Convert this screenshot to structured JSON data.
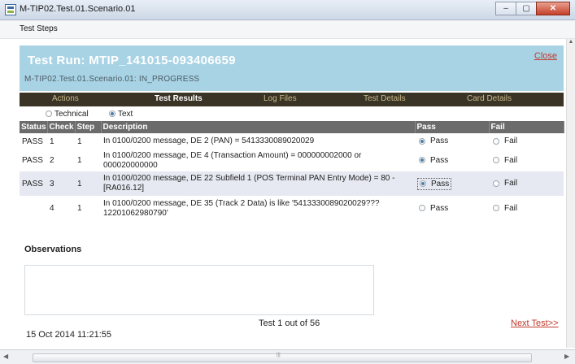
{
  "window": {
    "title": "M-TIP02.Test.01.Scenario.01",
    "minimize": "–",
    "maximize": "▢",
    "close": "✕"
  },
  "menu": {
    "test_steps": "Test Steps"
  },
  "run": {
    "title": "Test Run: MTIP_141015-093406659",
    "subtitle": "M-TIP02.Test.01.Scenario.01: IN_PROGRESS",
    "close_link": "Close"
  },
  "nav": {
    "actions": "Actions",
    "test_results": "Test Results",
    "log_files": "Log Files",
    "test_details": "Test Details",
    "card_details": "Card Details"
  },
  "view": {
    "technical": "Technical",
    "text": "Text",
    "selected": "Text"
  },
  "table": {
    "headers": {
      "status": "Status",
      "check": "Check",
      "step": "Step",
      "description": "Description",
      "pass": "Pass",
      "fail": "Fail"
    },
    "rows": [
      {
        "status": "PASS",
        "check": "1",
        "step": "1",
        "description": "In 0100/0200 message, DE 2 (PAN) = 5413330089020029",
        "pass": "Pass",
        "fail": "Fail",
        "selected": "pass"
      },
      {
        "status": "PASS",
        "check": "2",
        "step": "1",
        "description": "In 0100/0200 message, DE 4 (Transaction Amount) = 000000002000 or 000020000000",
        "pass": "Pass",
        "fail": "Fail",
        "selected": "pass"
      },
      {
        "status": "PASS",
        "check": "3",
        "step": "1",
        "description": "In 0100/0200 message, DE 22 Subfield 1 (POS Terminal PAN Entry Mode) = 80 - [RA016.12]",
        "pass": "Pass",
        "fail": "Fail",
        "selected": "pass"
      },
      {
        "status": "",
        "check": "4",
        "step": "1",
        "description": "In 0100/0200 message, DE 35 (Track 2 Data) is like '5413330089020029???12201062980790'",
        "pass": "Pass",
        "fail": "Fail",
        "selected": "none"
      }
    ]
  },
  "observations": {
    "label": "Observations",
    "value": ""
  },
  "footer": {
    "count": "Test 1 out of 56",
    "next": "Next Test>>",
    "timestamp": "15 Oct 2014 11:21:55"
  }
}
